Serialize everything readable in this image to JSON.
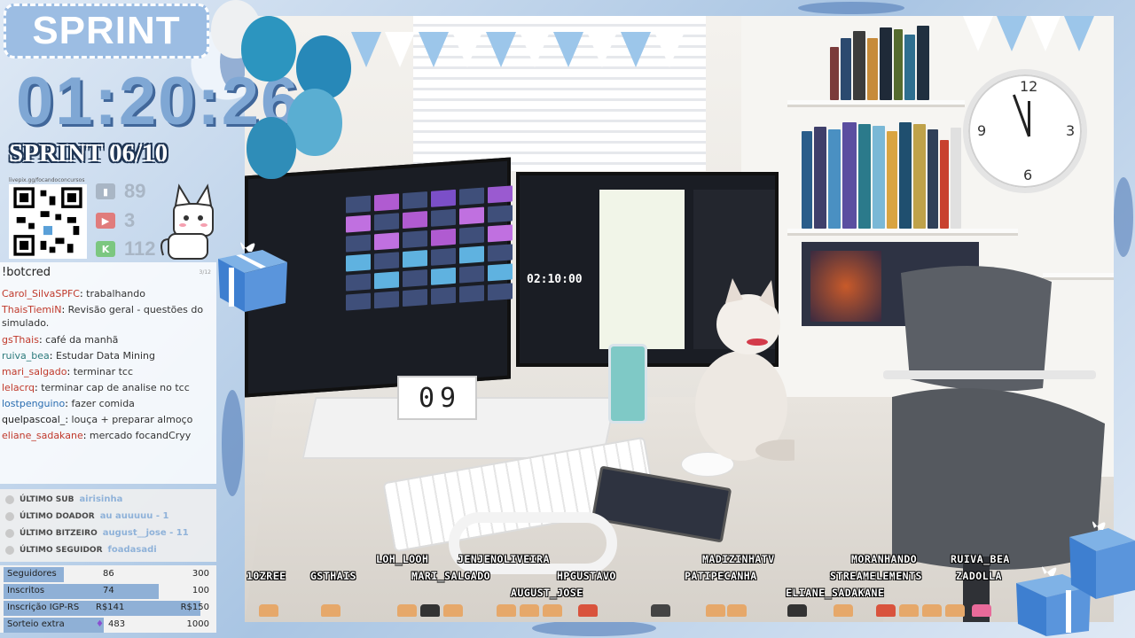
{
  "overlay": {
    "title": "SPRINT",
    "countdown": "01:20:26",
    "sprint_counter": "SPRINT 06/10",
    "qr_caption": "livepix.gg/focandoconcursos"
  },
  "stats": [
    {
      "platform": "twitch",
      "icon": "twitch-icon",
      "value": "89",
      "color": "#a9b6c5"
    },
    {
      "platform": "youtube",
      "icon": "youtube-icon",
      "value": "3",
      "color": "#e06060"
    },
    {
      "platform": "kick",
      "icon": "kick-icon",
      "value": "112",
      "color": "#6cc070"
    }
  ],
  "chat": {
    "command": "!botcred",
    "count": "3/12",
    "messages": [
      {
        "user": "Carol_SilvaSPFC",
        "text": "trabalhando",
        "color": "#c0392b"
      },
      {
        "user": "ThaisTiemiN",
        "text": "Revisão geral - questões do simulado.",
        "color": "#c0392b"
      },
      {
        "user": "gsThais",
        "text": "café da manhã",
        "color": "#c0392b"
      },
      {
        "user": "ruiva_bea",
        "text": "Estudar Data Mining",
        "color": "#2c7a7b"
      },
      {
        "user": "mari_salgado",
        "text": "terminar tcc",
        "color": "#c0392b"
      },
      {
        "user": "lelacrq",
        "text": "terminar cap de analise no tcc",
        "color": "#c0392b"
      },
      {
        "user": "lostpenguino",
        "text": "fazer comida",
        "color": "#2a6db0"
      },
      {
        "user": "quelpascoal_",
        "text": "louça + preparar almoço",
        "color": "#222222"
      },
      {
        "user": "eliane_sadakane",
        "text": "mercado focandCryy",
        "color": "#c0392b"
      }
    ]
  },
  "latest": [
    {
      "label": "ÚLTIMO SUB",
      "value": "airisinha"
    },
    {
      "label": "ÚLTIMO DOADOR",
      "value": "au auuuuu - 1"
    },
    {
      "label": "ÚLTIMO BITZEIRO",
      "value": "august__jose - 11"
    },
    {
      "label": "ÚLTIMO SEGUIDOR",
      "value": "foadasadi"
    }
  ],
  "goals": [
    {
      "label": "Seguidores",
      "current": "86",
      "target": "300",
      "progress": 0.29
    },
    {
      "label": "Inscritos",
      "current": "74",
      "target": "100",
      "progress": 0.74
    },
    {
      "label": "Inscrição IGP-RS",
      "current": "R$141",
      "target": "R$150",
      "progress": 0.94
    },
    {
      "label": "Sorteio extra",
      "current": "483",
      "target": "1000",
      "progress": 0.48
    }
  ],
  "scene": {
    "desk_calendar": [
      "0",
      "9"
    ],
    "monitor_timer": "02:10:00"
  },
  "credits": [
    "LOH_LOOH",
    "JENJENOLIVEIRA",
    "MADIZINHATV",
    "MORANHANDO",
    "RUIVA_BEA",
    "10ZREE",
    "GSTHAIS",
    "MARI_SALGADO",
    "HPGUSTAVO",
    "PATIPECANHA",
    "STREAMELEMENTS",
    "ZADOLLA",
    "AUGUST_JOSE",
    "ELIANE_SADAKANE"
  ],
  "colors": {
    "accent": "#9cbde3",
    "timer": "#7fa7d4",
    "goal_fill": "#8fb0d6"
  }
}
